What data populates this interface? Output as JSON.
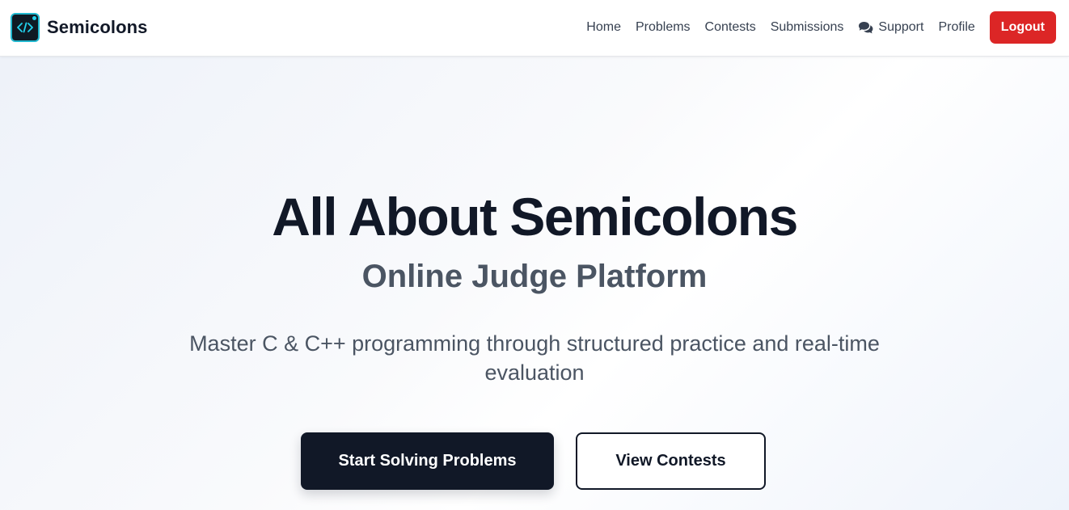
{
  "brand": {
    "name": "Semicolons",
    "logo_icon": "code-brackets-icon"
  },
  "nav": {
    "items": [
      {
        "label": "Home"
      },
      {
        "label": "Problems"
      },
      {
        "label": "Contests"
      },
      {
        "label": "Submissions"
      },
      {
        "label": "Support",
        "icon": "chat-bubbles-icon"
      },
      {
        "label": "Profile"
      }
    ],
    "logout_label": "Logout"
  },
  "hero": {
    "title": "All About Semicolons",
    "subtitle": "Online Judge Platform",
    "description": "Master C & C++ programming through structured practice and real-time evaluation",
    "primary_cta": "Start Solving Problems",
    "secondary_cta": "View Contests"
  },
  "colors": {
    "accent_danger": "#dc2626",
    "primary_dark": "#111827",
    "logo_accent": "#22b8cf"
  }
}
